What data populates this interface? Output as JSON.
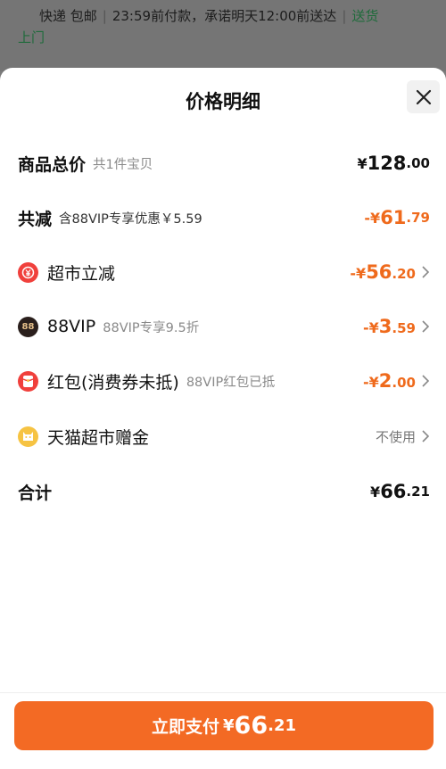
{
  "background": {
    "line1_left": "快递 包邮",
    "line1_mid": "23:59前付款，承诺明天12:00前送达",
    "line1_right": "送货",
    "line2": "上门"
  },
  "sheet": {
    "title": "价格明细"
  },
  "rows": {
    "total": {
      "label": "商品总价",
      "sub": "共1件宝贝",
      "currency": "¥",
      "int": "128",
      "dec": ".00"
    },
    "discount": {
      "label": "共减",
      "sub": "含88VIP专享优惠￥5.59",
      "currency": "-¥",
      "int": "61",
      "dec": ".79"
    },
    "supermarket": {
      "label": "超市立减",
      "sub": "",
      "currency": "-¥",
      "int": "56",
      "dec": ".20"
    },
    "vip": {
      "label": "88VIP",
      "sub": "88VIP专享9.5折",
      "icon_text": "88",
      "currency": "-¥",
      "int": "3",
      "dec": ".59"
    },
    "redpacket": {
      "label": "红包(消费券未抵)",
      "sub": "88VIP红包已抵",
      "currency": "-¥",
      "int": "2",
      "dec": ".00"
    },
    "gift": {
      "label": "天猫超市赠金",
      "right": "不使用"
    },
    "sum": {
      "label": "合计",
      "currency": "¥",
      "int": "66",
      "dec": ".21"
    }
  },
  "pay_button": {
    "label": "立即支付",
    "currency": "¥",
    "int": "66",
    "dec": ".21"
  },
  "colors": {
    "accent": "#f36a24",
    "discount": "#ef6a1c"
  }
}
